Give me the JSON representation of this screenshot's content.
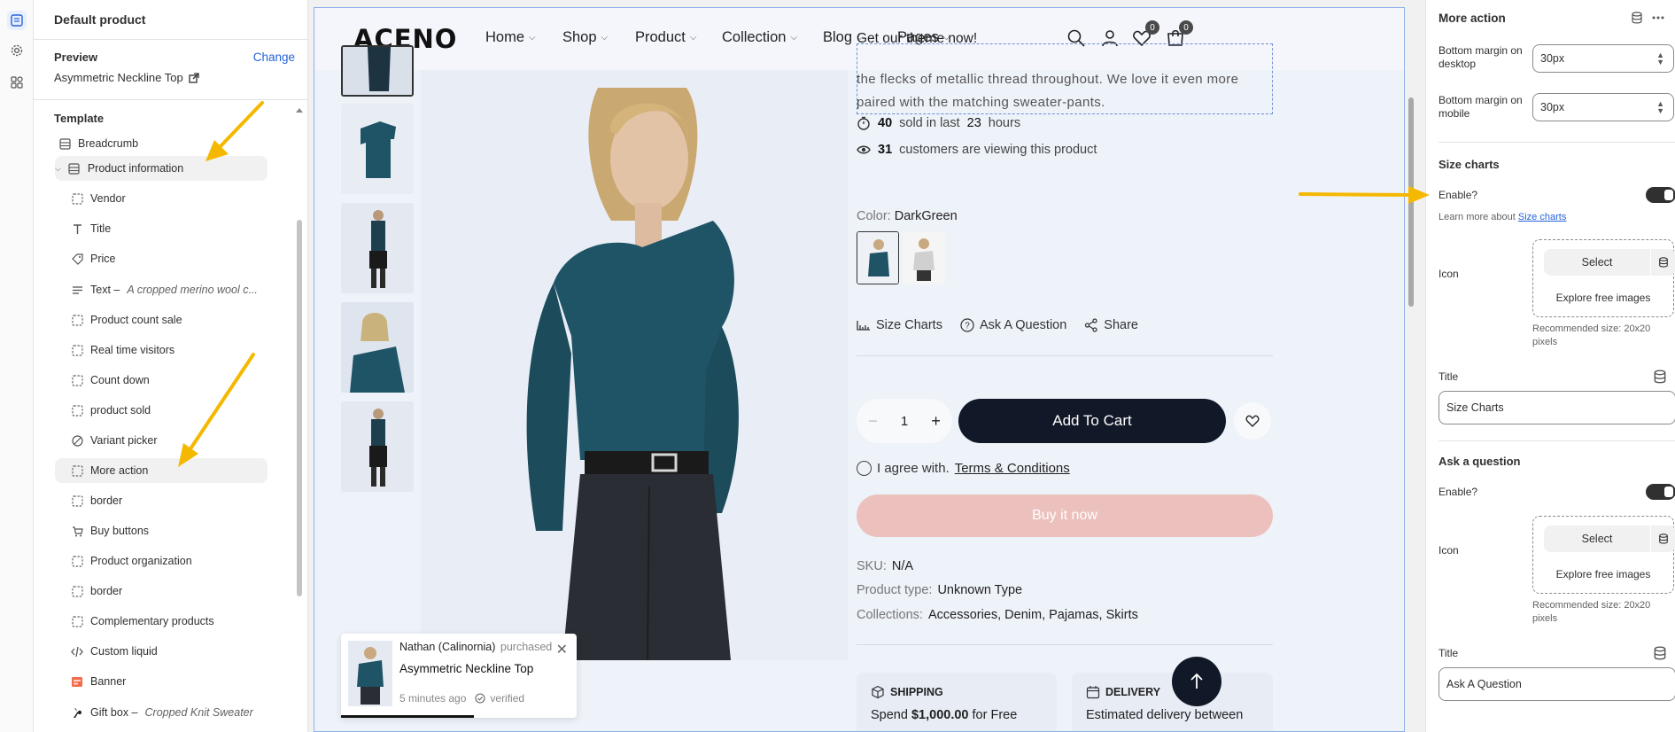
{
  "left_panel": {
    "title": "Default product",
    "preview_label": "Preview",
    "change_label": "Change",
    "preview_product": "Asymmetric Neckline Top",
    "template_label": "Template",
    "items": [
      {
        "label": "Breadcrumb",
        "icon": "section-icon"
      },
      {
        "label": "Product information",
        "icon": "section-icon"
      },
      {
        "label": "Vendor",
        "icon": "block-icon"
      },
      {
        "label": "Title",
        "icon": "text-icon"
      },
      {
        "label": "Price",
        "icon": "price-tag-icon"
      },
      {
        "label": "Text –",
        "sub": "A cropped merino wool c...",
        "icon": "paragraph-icon"
      },
      {
        "label": "Product count sale",
        "icon": "block-icon"
      },
      {
        "label": "Real time visitors",
        "icon": "block-icon"
      },
      {
        "label": "Count down",
        "icon": "block-icon"
      },
      {
        "label": "product sold",
        "icon": "block-icon"
      },
      {
        "label": "Variant picker",
        "icon": "variant-icon"
      },
      {
        "label": "More action",
        "icon": "block-icon"
      },
      {
        "label": "border",
        "icon": "block-icon"
      },
      {
        "label": "Buy buttons",
        "icon": "buy-button-icon"
      },
      {
        "label": "Product organization",
        "icon": "block-icon"
      },
      {
        "label": "border",
        "icon": "block-icon"
      },
      {
        "label": "Complementary products",
        "icon": "block-icon"
      },
      {
        "label": "Custom liquid",
        "icon": "code-icon"
      },
      {
        "label": "Banner",
        "icon": "banner-icon"
      },
      {
        "label": "Gift box –",
        "sub": "Cropped Knit Sweater",
        "icon": "gift-icon"
      }
    ]
  },
  "store": {
    "logo": "ACENO",
    "nav": [
      "Home",
      "Shop",
      "Product",
      "Collection",
      "Blog",
      "Pages"
    ],
    "promo": "Get our theme now!",
    "wishlist_count": "0",
    "cart_count": "0",
    "description": "the flecks of metallic thread throughout. We love it even more paired with the matching sweater-pants.",
    "sold_count": "40",
    "sold_text": "sold in last",
    "sold_hours": "23",
    "sold_hours_label": "hours",
    "viewing_count": "31",
    "viewing_text": "customers are viewing this product",
    "color_label": "Color:",
    "color_value": "DarkGreen",
    "more_actions": [
      "Size Charts",
      "Ask A Question",
      "Share"
    ],
    "quantity": "1",
    "add_to_cart": "Add To Cart",
    "agree_text": "I agree with.",
    "terms": "Terms & Conditions",
    "buy_now": "Buy it now",
    "sku_label": "SKU:",
    "sku_value": "N/A",
    "type_label": "Product type:",
    "type_value": "Unknown Type",
    "collections_label": "Collections:",
    "collections_value": "Accessories, Denim, Pajamas, Skirts",
    "shipping_title": "SHIPPING",
    "shipping_text_pre": "Spend",
    "shipping_amount": "$1,000.00",
    "shipping_text_post": "for Free",
    "delivery_title": "DELIVERY",
    "delivery_text": "Estimated delivery between",
    "popup": {
      "name": "Nathan (Calinornia)",
      "action": "purchased",
      "product": "Asymmetric Neckline Top",
      "time": "5 minutes ago",
      "verified": "verified"
    }
  },
  "right_panel": {
    "title": "More action",
    "bottom_desktop_label": "Bottom margin on desktop",
    "bottom_desktop_value": "30px",
    "bottom_mobile_label": "Bottom margin on mobile",
    "bottom_mobile_value": "30px",
    "size_charts": {
      "heading": "Size charts",
      "enable_label": "Enable?",
      "enabled": true,
      "learn_text": "Learn more about",
      "learn_link": "Size charts",
      "icon_label": "Icon",
      "select_label": "Select",
      "explore_label": "Explore free images",
      "recommended": "Recommended size: 20x20 pixels",
      "title_label": "Title",
      "title_value": "Size Charts"
    },
    "ask_question": {
      "heading": "Ask a question",
      "enable_label": "Enable?",
      "enabled": true,
      "icon_label": "Icon",
      "select_label": "Select",
      "explore_label": "Explore free images",
      "recommended": "Recommended size: 20x20 pixels",
      "title_label": "Title",
      "title_value": "Ask A Question"
    }
  },
  "colors": {
    "accent": "#2463d8",
    "annotation_arrow": "#f5b800",
    "dark_button": "#111827",
    "buy_now_button": "#ebc0bd"
  }
}
